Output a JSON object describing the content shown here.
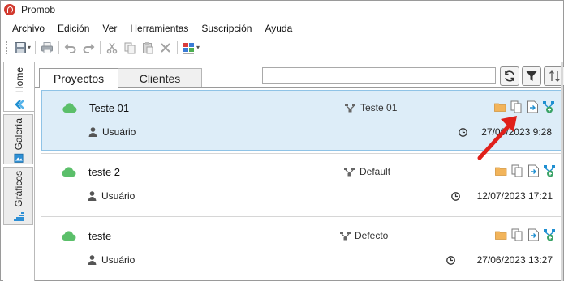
{
  "window": {
    "title": "Promob"
  },
  "menu": [
    "Archivo",
    "Edición",
    "Ver",
    "Herramientas",
    "Suscripción",
    "Ayuda"
  ],
  "toolbar": {
    "icons": [
      "save-icon",
      "print-icon",
      "undo-icon",
      "redo-icon",
      "cut-icon",
      "copy-icon",
      "paste-icon",
      "delete-icon",
      "render-color-icon"
    ]
  },
  "sidebar": {
    "tabs": [
      {
        "label": "Home",
        "icon": "home-chevron-icon",
        "active": true
      },
      {
        "label": "Galería",
        "icon": "gallery-icon",
        "active": false
      },
      {
        "label": "Gráficos",
        "icon": "chart-icon",
        "active": false
      }
    ]
  },
  "tabs": [
    {
      "label": "Proyectos",
      "active": true
    },
    {
      "label": "Clientes",
      "active": false
    }
  ],
  "search": {
    "value": "",
    "placeholder": ""
  },
  "projects": [
    {
      "name": "Teste 01",
      "user": "Usuário",
      "library": "Teste 01",
      "date": "27/09/2023 9:28",
      "selected": true
    },
    {
      "name": "teste 2",
      "user": "Usuário",
      "library": "Default",
      "date": "12/07/2023 17:21",
      "selected": false
    },
    {
      "name": "teste",
      "user": "Usuário",
      "library": "Defecto",
      "date": "27/06/2023 13:27",
      "selected": false
    }
  ],
  "colors": {
    "selection_bg": "#ddedf8",
    "selection_border": "#8fc3e6",
    "cloud": "#5bbf6a",
    "folder": "#f2b45a",
    "annotation_arrow": "#e0201a",
    "accent_blue": "#1f8fd1"
  }
}
